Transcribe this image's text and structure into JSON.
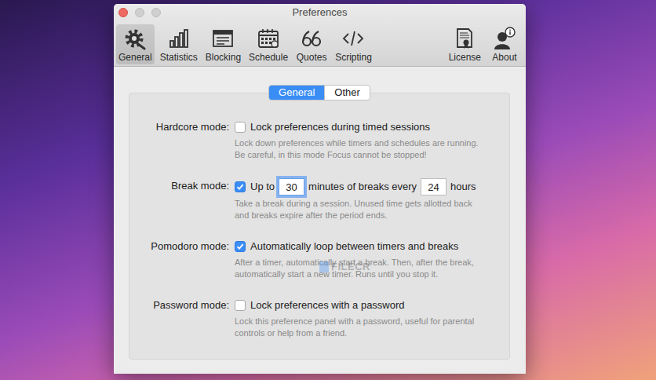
{
  "window": {
    "title": "Preferences"
  },
  "toolbar": [
    {
      "label": "General",
      "selected": true
    },
    {
      "label": "Statistics",
      "selected": false
    },
    {
      "label": "Blocking",
      "selected": false
    },
    {
      "label": "Schedule",
      "selected": false
    },
    {
      "label": "Quotes",
      "selected": false
    },
    {
      "label": "Scripting",
      "selected": false
    },
    {
      "label": "License",
      "selected": false
    },
    {
      "label": "About",
      "selected": false
    }
  ],
  "segments": [
    {
      "label": "General",
      "selected": true
    },
    {
      "label": "Other",
      "selected": false
    }
  ],
  "settings": [
    {
      "label": "Hardcore mode:",
      "kind": "checkbox",
      "checked": false,
      "text": "Lock preferences during timed sessions",
      "description": "Lock down preferences while timers and schedules are running. Be careful, in this mode Focus cannot be stopped!"
    },
    {
      "label": "Break mode:",
      "kind": "interval",
      "checked": true,
      "texts": [
        "Up to",
        "minutes of breaks every",
        "hours"
      ],
      "fields": [
        {
          "value": "30",
          "focused": true
        },
        {
          "value": "24",
          "focused": false
        }
      ],
      "description": "Take a break during a session. Unused time gets allotted back and breaks expire after the period ends."
    },
    {
      "label": "Pomodoro mode:",
      "kind": "checkbox",
      "checked": true,
      "text": "Automatically loop between timers and breaks",
      "description": "After a timer, automatically start a break. Then, after the break, automatically start a new timer. Runs until you stop it."
    },
    {
      "label": "Password mode:",
      "kind": "checkbox",
      "checked": false,
      "text": "Lock preferences with a password",
      "description": "Lock this preference panel with a password, useful for parental controls or help from a friend."
    }
  ],
  "watermark": "FILECR"
}
